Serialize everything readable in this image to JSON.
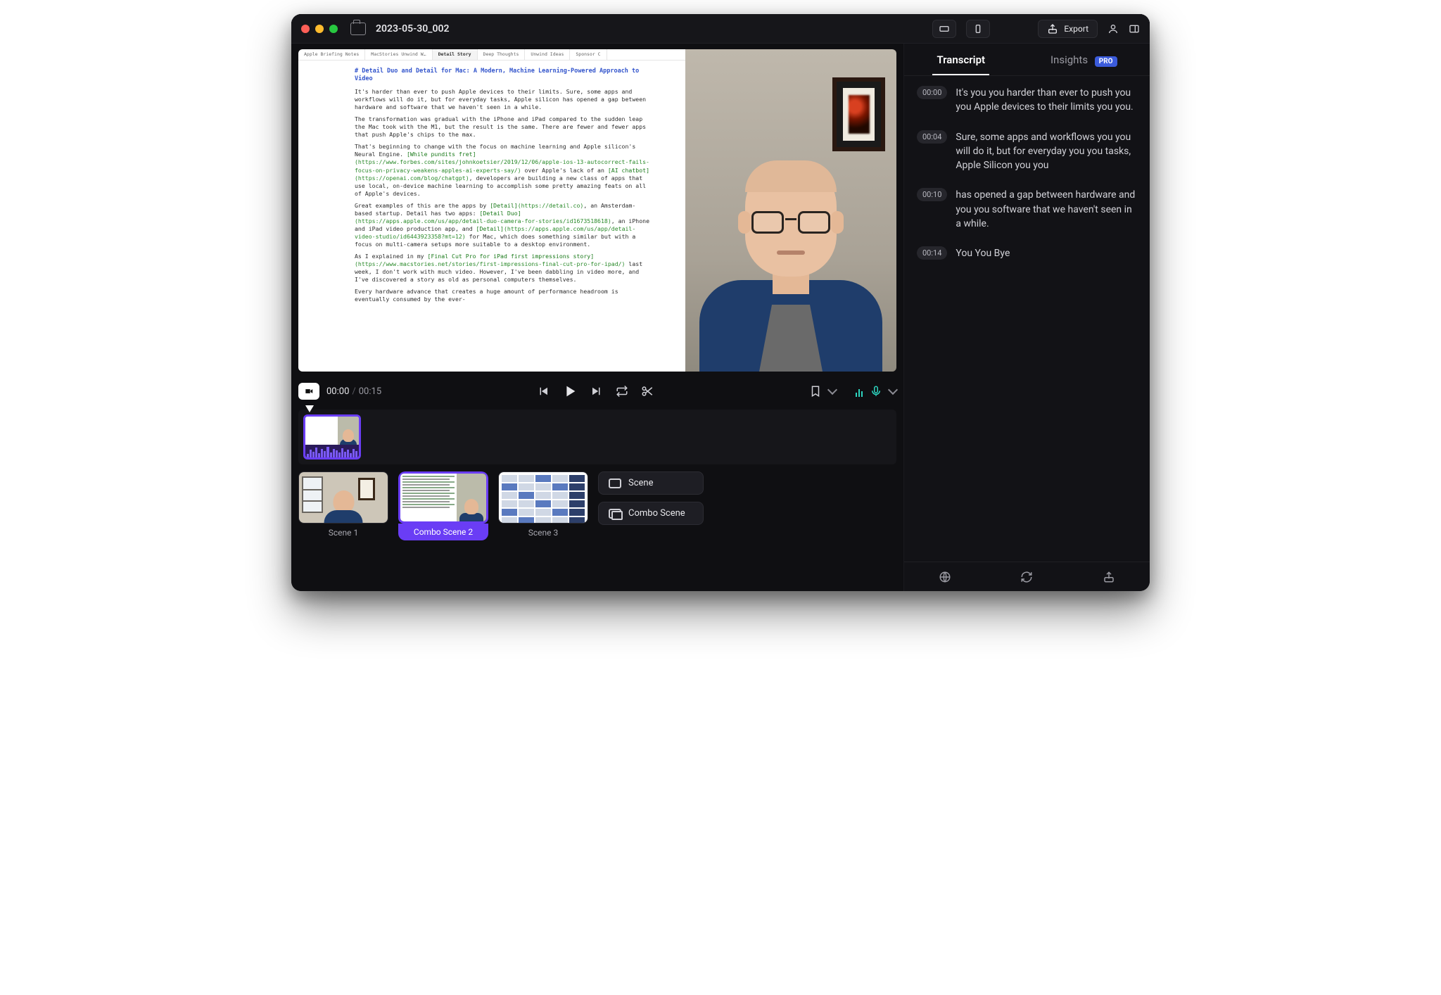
{
  "window": {
    "title": "2023-05-30_002"
  },
  "titlebar": {
    "export_label": "Export"
  },
  "preview": {
    "doc_tabs": [
      "Apple Briefing Notes",
      "MacStories Unwind W…",
      "Detail Story",
      "Deep Thoughts",
      "Unwind Ideas",
      "Sponsor C"
    ],
    "doc_active_tab": "Detail Story",
    "doc_heading": "# Detail Duo and Detail for Mac: A Modern, Machine Learning-Powered Approach to Video",
    "doc_p1": "It's harder than ever to push Apple devices to their limits. Sure, some apps and workflows will do it, but for everyday tasks, Apple silicon has opened a gap between hardware and software that we haven't seen in a while.",
    "doc_p2": "The transformation was gradual with the iPhone and iPad compared to the sudden leap the Mac took with the M1, but the result is the same. There are fewer and fewer apps that push Apple's chips to the max.",
    "doc_p3a": "That's beginning to change with the focus on machine learning and Apple silicon's Neural Engine. ",
    "doc_link1_text": "[While pundits fret]",
    "doc_link1_url": "(https://www.forbes.com/sites/johnkoetsier/2019/12/06/apple-ios-13-autocorrect-fails-focus-on-privacy-weakens-apples-ai-experts-say/)",
    "doc_p3b": " over Apple's lack of an ",
    "doc_link2_text": "[AI chatbot]",
    "doc_link2_url": "(https://openai.com/blog/chatgpt)",
    "doc_p3c": ", developers are building a new class of apps that use local, on-device machine learning to accomplish some pretty amazing feats on all of Apple's devices.",
    "doc_p4a": "Great examples of this are the apps by ",
    "doc_link3_text": "[Detail]",
    "doc_link3_url": "(https://detail.co)",
    "doc_p4b": ", an Amsterdam-based startup. Detail has two apps: ",
    "doc_link4_text": "[Detail Duo]",
    "doc_link4_url": "(https://apps.apple.com/us/app/detail-duo-camera-for-stories/id1673518618)",
    "doc_p4c": ", an iPhone and iPad video production app, and ",
    "doc_link5_text": "[Detail]",
    "doc_link5_url": "(https://apps.apple.com/us/app/detail-video-studio/id6443923358?mt=12)",
    "doc_p4d": " for Mac, which does something similar but with a focus on multi-camera setups more suitable to a desktop environment.",
    "doc_p5a": "As I explained in my ",
    "doc_link6_text": "[Final Cut Pro for iPad first impressions story]",
    "doc_link6_url": "(https://www.macstories.net/stories/first-impressions-final-cut-pro-for-ipad/)",
    "doc_p5b": " last week, I don't work with much video. However, I've been dabbling in video more, and I've discovered a story as old as personal computers themselves.",
    "doc_p6": "Every hardware advance that creates a huge amount of performance headroom is eventually consumed by the ever-"
  },
  "playback": {
    "current": "00:00",
    "duration": "00:15"
  },
  "scenes": {
    "items": [
      {
        "label": "Scene 1"
      },
      {
        "label": "Combo Scene 2"
      },
      {
        "label": "Scene 3"
      }
    ],
    "add_scene_label": "Scene",
    "add_combo_label": "Combo Scene"
  },
  "right_tabs": {
    "transcript": "Transcript",
    "insights": "Insights",
    "pro_badge": "PRO"
  },
  "transcript": [
    {
      "t": "00:00",
      "text": "It's you you harder than ever to push you you Apple devices to their limits you you."
    },
    {
      "t": "00:04",
      "text": "Sure, some apps and workflows you you will do it, but for everyday you you tasks, Apple Silicon you you"
    },
    {
      "t": "00:10",
      "text": "has opened a gap between hardware and you you software that we haven't seen in a while."
    },
    {
      "t": "00:14",
      "text": "You You Bye"
    }
  ]
}
